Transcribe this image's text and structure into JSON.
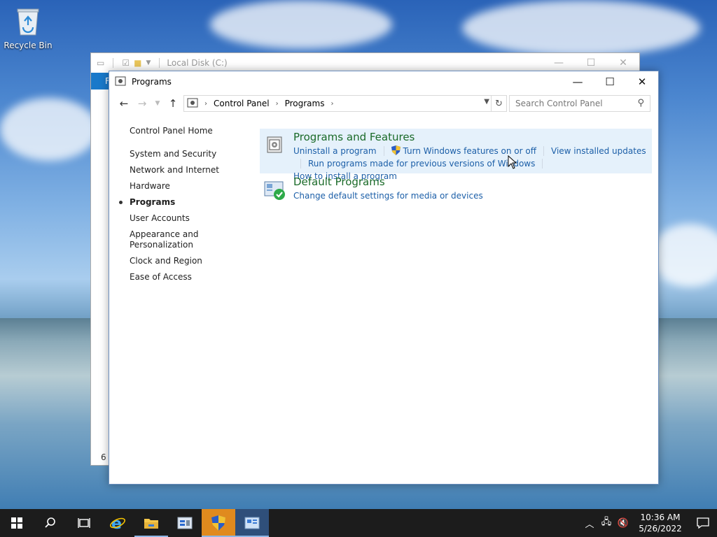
{
  "desktop": {
    "recycle_bin_label": "Recycle Bin"
  },
  "back_window": {
    "title": "Local Disk (C:)",
    "ribbon_tab": "F",
    "status": "6 i"
  },
  "window": {
    "title": "Programs",
    "minimize": "—",
    "maximize": "☐",
    "close": "✕",
    "breadcrumb": [
      "Control Panel",
      "Programs"
    ],
    "search_placeholder": "Search Control Panel"
  },
  "sidebar": {
    "items": [
      {
        "label": "Control Panel Home"
      },
      {
        "label": "System and Security"
      },
      {
        "label": "Network and Internet"
      },
      {
        "label": "Hardware"
      },
      {
        "label": "Programs"
      },
      {
        "label": "User Accounts"
      },
      {
        "label": "Appearance and Personalization"
      },
      {
        "label": "Clock and Region"
      },
      {
        "label": "Ease of Access"
      }
    ],
    "active": "Programs"
  },
  "groups": [
    {
      "title": "Programs and Features",
      "icon": "programs-features-icon",
      "links": [
        "Uninstall a program",
        "Turn Windows features on or off",
        "View installed updates",
        "Run programs made for previous versions of Windows",
        "How to install a program"
      ]
    },
    {
      "title": "Default Programs",
      "icon": "default-programs-icon",
      "links": [
        "Change default settings for media or devices"
      ]
    }
  ],
  "taskbar": {
    "clock_time": "10:36 AM",
    "clock_date": "5/26/2022"
  },
  "colors": {
    "link": "#1c5fa8",
    "group_title": "#1a6a28",
    "highlight": "#e5f1fb",
    "taskbar": "#1c1c1c"
  }
}
